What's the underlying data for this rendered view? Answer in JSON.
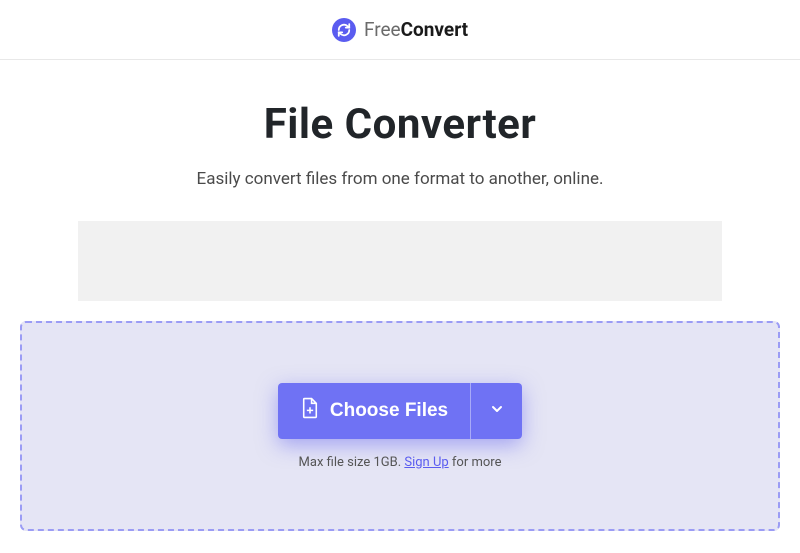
{
  "header": {
    "logo_light": "Free",
    "logo_bold": "Convert"
  },
  "main": {
    "title": "File Converter",
    "subtitle": "Easily convert files from one format to another, online."
  },
  "dropzone": {
    "choose_label": "Choose Files",
    "hint_prefix": "Max file size 1GB. ",
    "signup_label": "Sign Up",
    "hint_suffix": " for more"
  }
}
